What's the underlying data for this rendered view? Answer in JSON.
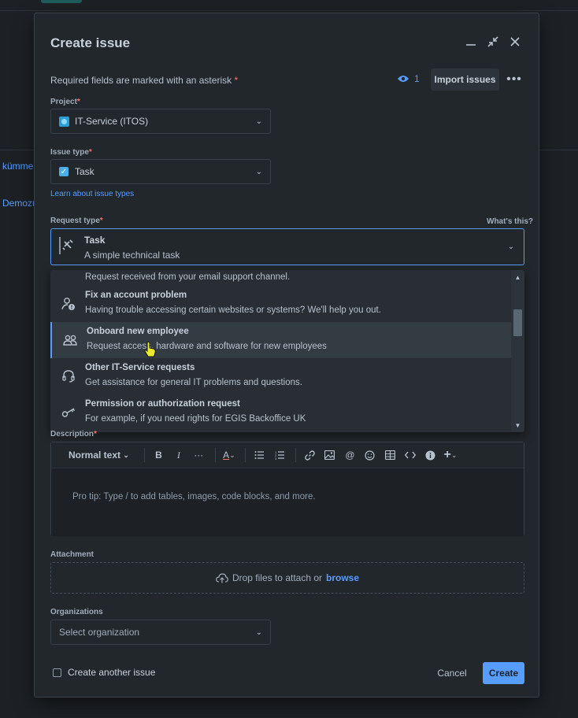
{
  "background": {
    "link1": "kümmer",
    "link2": "Demozu"
  },
  "modal": {
    "title": "Create issue",
    "required_note": "Required fields are marked with an asterisk",
    "asterisk": "*",
    "watchers_count": "1",
    "import_label": "Import issues",
    "project": {
      "label": "Project",
      "value": "IT-Service (ITOS)"
    },
    "issue_type": {
      "label": "Issue type",
      "value": "Task",
      "learn_link": "Learn about issue types"
    },
    "request_type": {
      "label": "Request type",
      "whats_this": "What's this?",
      "selected_title": "Task",
      "selected_desc": "A simple technical task",
      "options": [
        {
          "title": "",
          "desc": "Request received from your email support channel.",
          "icon": "email-icon"
        },
        {
          "title": "Fix an account problem",
          "desc": "Having trouble accessing certain websites or systems? We'll help you out.",
          "icon": "account-problem-icon"
        },
        {
          "title": "Onboard new employee",
          "desc": "Request access, hardware and software for new employees",
          "icon": "people-icon"
        },
        {
          "title": "Other IT-Service requests",
          "desc": "Get assistance for general IT problems and questions.",
          "icon": "headset-icon"
        },
        {
          "title": "Permission or authorization request",
          "desc": "For example, if you need rights for EGIS Backoffice UK",
          "icon": "key-icon"
        }
      ]
    },
    "description": {
      "label": "Description",
      "text_style": "Normal text",
      "placeholder": "Pro tip: Type / to add tables, images, code blocks, and more."
    },
    "attachment": {
      "label": "Attachment",
      "drop_text": "Drop files to attach or",
      "browse": "browse"
    },
    "organizations": {
      "label": "Organizations",
      "placeholder": "Select organization"
    },
    "footer": {
      "create_another": "Create another issue",
      "cancel": "Cancel",
      "create": "Create"
    }
  },
  "colors": {
    "accent": "#579dff",
    "required": "#f87168",
    "modal_bg": "#22272b"
  }
}
